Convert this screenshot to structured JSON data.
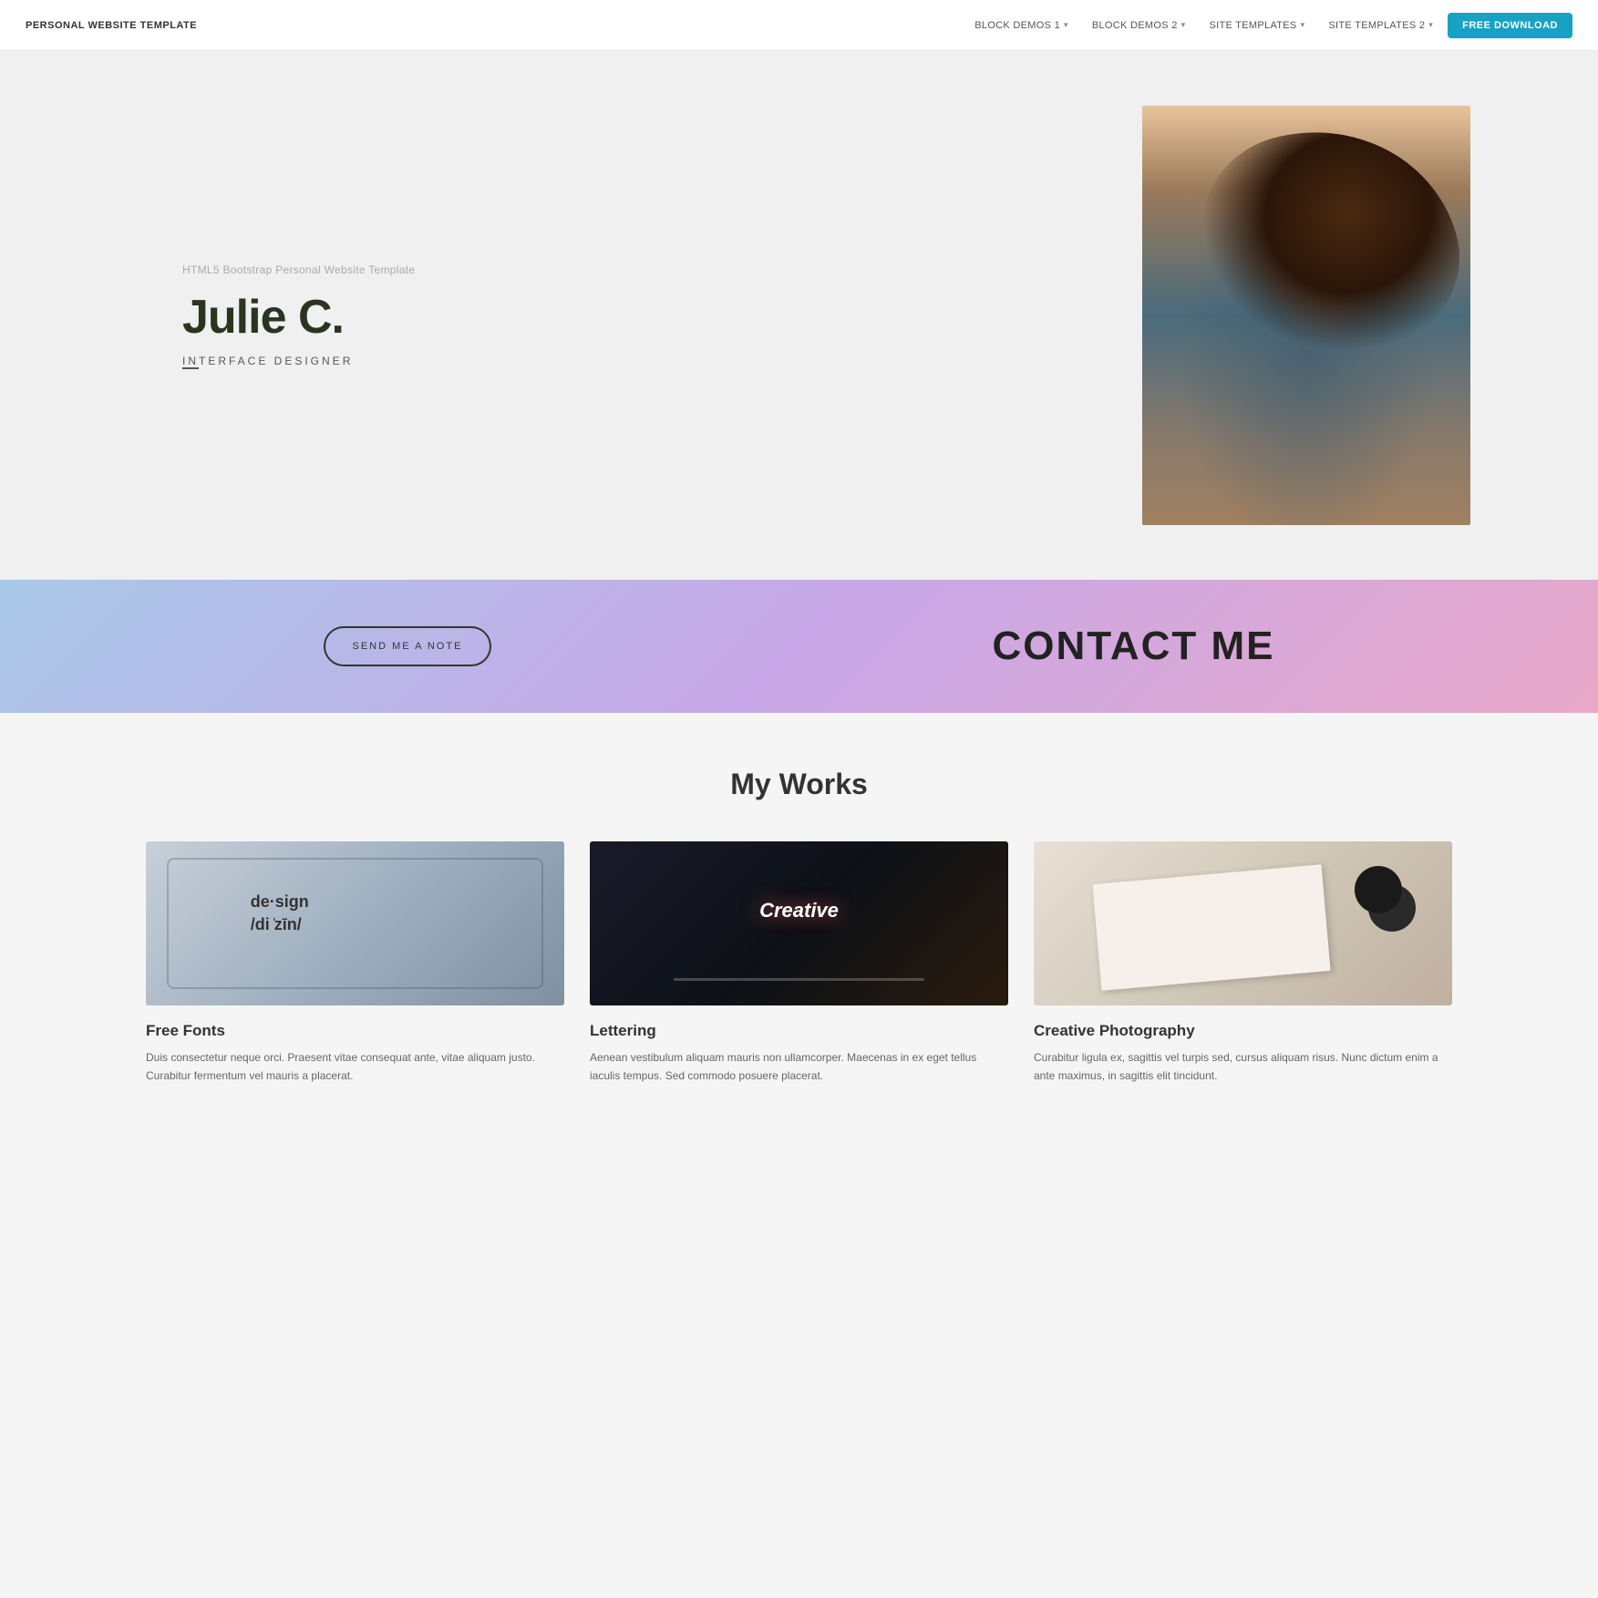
{
  "nav": {
    "logo": "PERSONAL WEBSITE TEMPLATE",
    "links": [
      {
        "label": "BLOCK DEMOS 1",
        "has_dropdown": true,
        "id": "block-demos-1"
      },
      {
        "label": "BLOCK DEMOS 2",
        "has_dropdown": true,
        "id": "block-demos-2"
      },
      {
        "label": "SITE TEMPLATES",
        "has_dropdown": true,
        "id": "site-templates"
      },
      {
        "label": "SITE TEMPLATES 2",
        "has_dropdown": true,
        "id": "site-templates-2"
      }
    ],
    "cta_label": "FREE DOWNLOAD"
  },
  "hero": {
    "subtitle": "HTML5 Bootstrap Personal Website Template",
    "name": "Julie C.",
    "role": "INTERFACE DESIGNER",
    "role_highlight": "IN"
  },
  "contact": {
    "button_label": "SEND ME A NOTE",
    "title": "CONTACT ME"
  },
  "works": {
    "section_title": "My Works",
    "items": [
      {
        "id": "free-fonts",
        "title": "Free Fonts",
        "description": "Duis consectetur neque orci. Praesent vitae consequat ante, vitae aliquam justo. Curabitur fermentum vel mauris a placerat."
      },
      {
        "id": "lettering",
        "title": "Lettering",
        "description": "Aenean vestibulum aliquam mauris non ullamcorper. Maecenas in ex eget tellus iaculis tempus. Sed commodo posuere placerat."
      },
      {
        "id": "creative-photography",
        "title": "Creative Photography",
        "description": "Curabitur ligula ex, sagittis vel turpis sed, cursus aliquam risus. Nunc dictum enim a ante maximus, in sagittis elit tincidunt."
      }
    ]
  }
}
